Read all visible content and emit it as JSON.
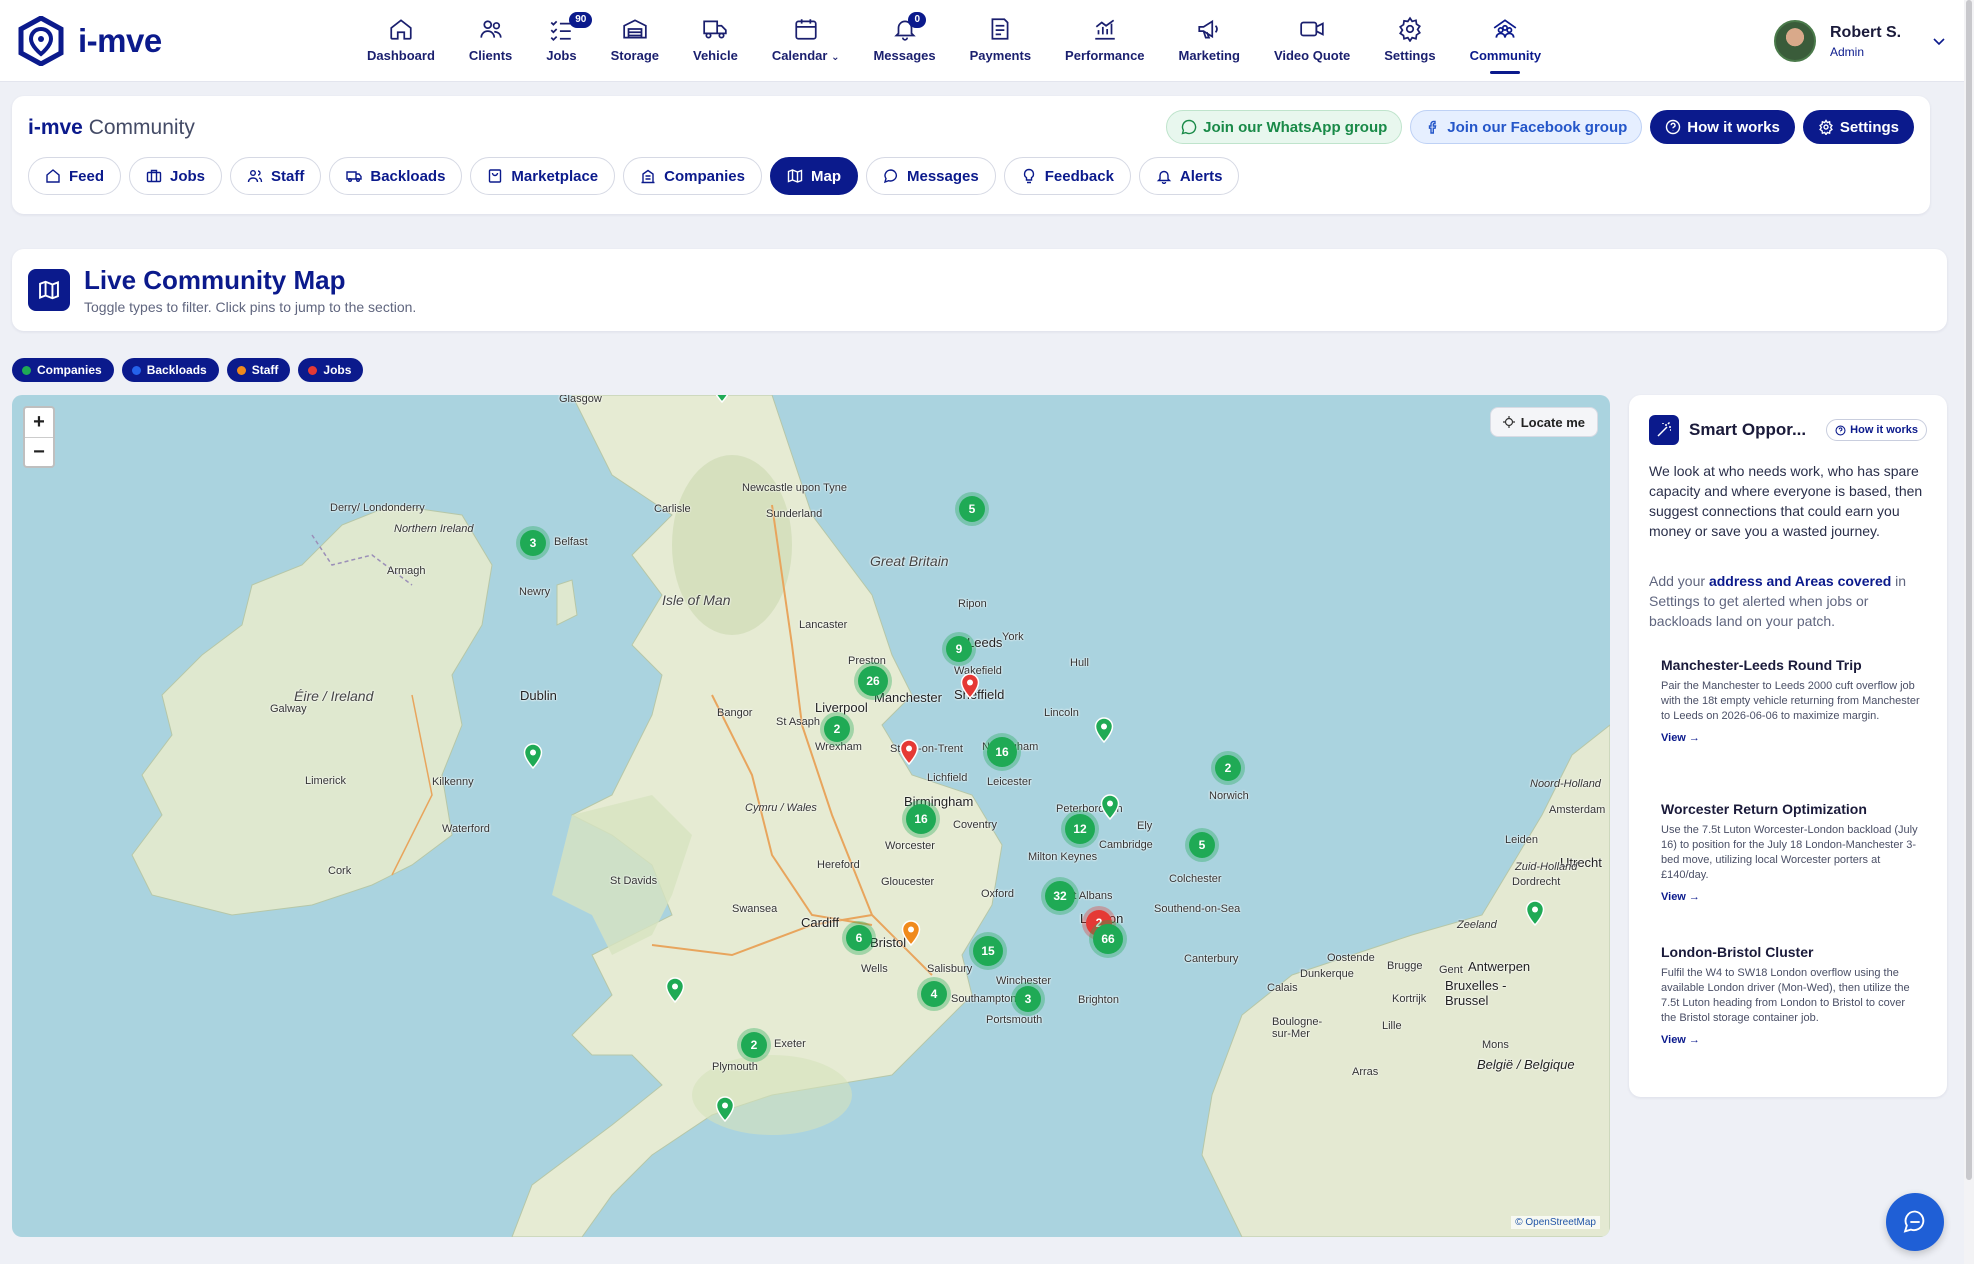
{
  "brand": {
    "name": "i-mve"
  },
  "nav": {
    "items": [
      {
        "label": "Dashboard",
        "icon": "home-icon"
      },
      {
        "label": "Clients",
        "icon": "users-icon"
      },
      {
        "label": "Jobs",
        "icon": "checklist-icon",
        "badge": "90"
      },
      {
        "label": "Storage",
        "icon": "warehouse-icon"
      },
      {
        "label": "Vehicle",
        "icon": "truck-icon"
      },
      {
        "label": "Calendar",
        "icon": "calendar-icon"
      },
      {
        "label": "Messages",
        "icon": "bell-icon",
        "badge": "0"
      },
      {
        "label": "Payments",
        "icon": "receipt-icon"
      },
      {
        "label": "Performance",
        "icon": "chart-icon"
      },
      {
        "label": "Marketing",
        "icon": "megaphone-icon"
      },
      {
        "label": "Video Quote",
        "icon": "video-icon"
      },
      {
        "label": "Settings",
        "icon": "gear-icon"
      },
      {
        "label": "Community",
        "icon": "community-icon",
        "active": true
      }
    ]
  },
  "user": {
    "name": "Robert S.",
    "role": "Admin"
  },
  "community": {
    "title_brand": "i-mve",
    "title_rest": "Community",
    "actions": {
      "whatsapp": "Join our WhatsApp group",
      "facebook": "Join our Facebook group",
      "how": "How it works",
      "settings": "Settings"
    },
    "tabs": [
      "Feed",
      "Jobs",
      "Staff",
      "Backloads",
      "Marketplace",
      "Companies",
      "Map",
      "Messages",
      "Feedback",
      "Alerts"
    ],
    "active_tab": "Map"
  },
  "live_map": {
    "title": "Live Community Map",
    "subtitle": "Toggle types to filter. Click pins to jump to the section.",
    "filters": [
      {
        "label": "Companies",
        "color": "#1faa55"
      },
      {
        "label": "Backloads",
        "color": "#2563eb"
      },
      {
        "label": "Staff",
        "color": "#f08a1c"
      },
      {
        "label": "Jobs",
        "color": "#e53935"
      }
    ],
    "locate": "Locate me",
    "attribution": "© OpenStreetMap",
    "zoom_in": "+",
    "zoom_out": "−",
    "places": [
      "Glasgow",
      "Newcastle upon Tyne",
      "Sunderland",
      "Carlisle",
      "Derry/ Londonderry",
      "Northern Ireland",
      "Belfast",
      "Armagh",
      "Newry",
      "Great Britain",
      "Isle of Man",
      "Ripon",
      "York",
      "Lancaster",
      "Preston",
      "Leeds",
      "Wakefield",
      "Hull",
      "Manchester",
      "Sheffield",
      "Liverpool",
      "Bangor",
      "St Asaph",
      "Wrexham",
      "Lincoln",
      "Stoke-on-Trent",
      "Nottingham",
      "Éire / Ireland",
      "Galway",
      "Dublin",
      "Limerick",
      "Kilkenny",
      "Waterford",
      "Cork",
      "Lichfield",
      "Leicester",
      "Norwich",
      "Birmingham",
      "Coventry",
      "Peterborough",
      "Ely",
      "Cymru / Wales",
      "Worcester",
      "Cambridge",
      "Hereford",
      "Milton Keynes",
      "St Davids",
      "Gloucester",
      "Oxford",
      "St Albans",
      "Colchester",
      "Swansea",
      "Cardiff",
      "London",
      "Southend-on-Sea",
      "Bristol",
      "Wells",
      "Salisbury",
      "Winchester",
      "Canterbury",
      "Southampton",
      "Portsmouth",
      "Brighton",
      "Exeter",
      "Plymouth",
      "Amsterdam",
      "Noord-Holland",
      "Leiden",
      "Utrecht",
      "Zuid-Holland",
      "Dordrecht",
      "Zeeland",
      "Antwerpen",
      "Oostende",
      "Brugge",
      "Gent",
      "Dunkerque",
      "Calais",
      "Kortrijk",
      "Bruxelles - Brussel",
      "Lille",
      "Boulogne-sur-Mer",
      "Arras",
      "Mons",
      "België / Belgique"
    ],
    "clusters": [
      {
        "label": "5",
        "type": "company"
      },
      {
        "label": "3",
        "type": "company"
      },
      {
        "label": "9",
        "type": "company"
      },
      {
        "label": "26",
        "type": "company"
      },
      {
        "label": "2",
        "type": "company"
      },
      {
        "label": "16",
        "type": "company"
      },
      {
        "label": "2",
        "type": "company"
      },
      {
        "label": "16",
        "type": "company"
      },
      {
        "label": "12",
        "type": "company"
      },
      {
        "label": "5",
        "type": "company"
      },
      {
        "label": "32",
        "type": "company"
      },
      {
        "label": "2",
        "type": "job"
      },
      {
        "label": "66",
        "type": "company"
      },
      {
        "label": "6",
        "type": "company"
      },
      {
        "label": "15",
        "type": "company"
      },
      {
        "label": "4",
        "type": "company"
      },
      {
        "label": "3",
        "type": "company"
      },
      {
        "label": "2",
        "type": "company"
      }
    ]
  },
  "smart": {
    "title": "Smart Oppor...",
    "how": "How it works",
    "intro": "We look at who needs work, who has spare capacity and where everyone is based, then suggest connections that could earn you money or save you a wasted journey.",
    "hint_pre": "Add your ",
    "hint_link": "address and Areas covered",
    "hint_post": " in Settings to get alerted when jobs or backloads land on your patch.",
    "opportunities": [
      {
        "title": "Manchester-Leeds Round Trip",
        "desc": "Pair the Manchester to Leeds 2000 cuft overflow job with the 18t empty vehicle returning from Manchester to Leeds on 2026-06-06 to maximize margin.",
        "view": "View →"
      },
      {
        "title": "Worcester Return Optimization",
        "desc": "Use the 7.5t Luton Worcester-London backload (July 16) to position for the July 18 London-Manchester 3-bed move, utilizing local Worcester porters at £140/day.",
        "view": "View →"
      },
      {
        "title": "London-Bristol Cluster",
        "desc": "Fulfil the W4 to SW18 London overflow using the available London driver (Mon-Wed), then utilize the 7.5t Luton heading from London to Bristol to cover the Bristol storage container job.",
        "view": "View →"
      }
    ]
  }
}
